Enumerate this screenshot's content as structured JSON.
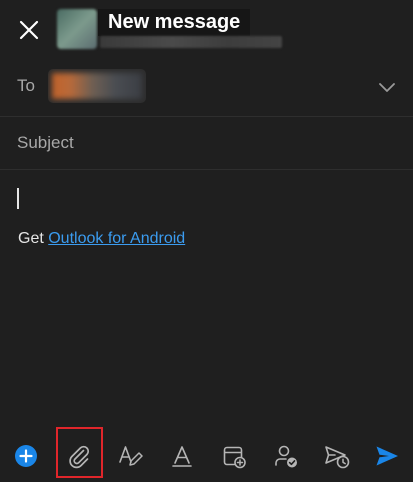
{
  "header": {
    "title": "New message",
    "close_icon": "close-icon"
  },
  "compose": {
    "to_label": "To",
    "subject_placeholder": "Subject",
    "subject_value": "",
    "signature_prefix": "Get ",
    "signature_link": "Outlook for Android"
  },
  "toolbar": {
    "items": [
      {
        "name": "add-icon",
        "active_color": "#1a86e8"
      },
      {
        "name": "attach-icon"
      },
      {
        "name": "draw-icon"
      },
      {
        "name": "format-text-icon"
      },
      {
        "name": "calendar-add-icon"
      },
      {
        "name": "availability-icon"
      },
      {
        "name": "schedule-send-icon"
      },
      {
        "name": "send-icon",
        "active_color": "#1a86e8"
      }
    ],
    "highlighted_item": "attach-icon"
  },
  "colors": {
    "background": "#1f1f1f",
    "accent": "#1a86e8",
    "link": "#3b9cf0",
    "highlight": "#e0262b"
  }
}
